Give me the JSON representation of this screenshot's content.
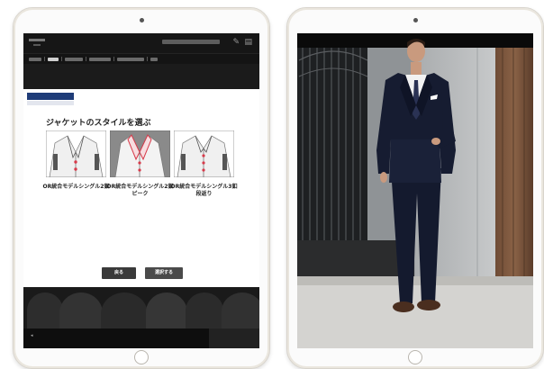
{
  "left_tablet": {
    "panel": {
      "title": "ジャケットのスタイルを選ぶ",
      "options": [
        {
          "label": "OR統合モデルシングル2釦",
          "selected": false
        },
        {
          "label": "OR統合モデルシングル2釦ピーク",
          "selected": true
        },
        {
          "label": "OR統合モデルシングル3釦段返り",
          "selected": false
        }
      ],
      "buttons": {
        "back": "戻る",
        "select": "選択する"
      }
    }
  },
  "colors": {
    "brand_navy": "#1f3c78",
    "selected_accent": "#d73a4a",
    "selected_bg": "#8a8a8a"
  },
  "icons": [
    "pen-icon",
    "document-icon"
  ]
}
